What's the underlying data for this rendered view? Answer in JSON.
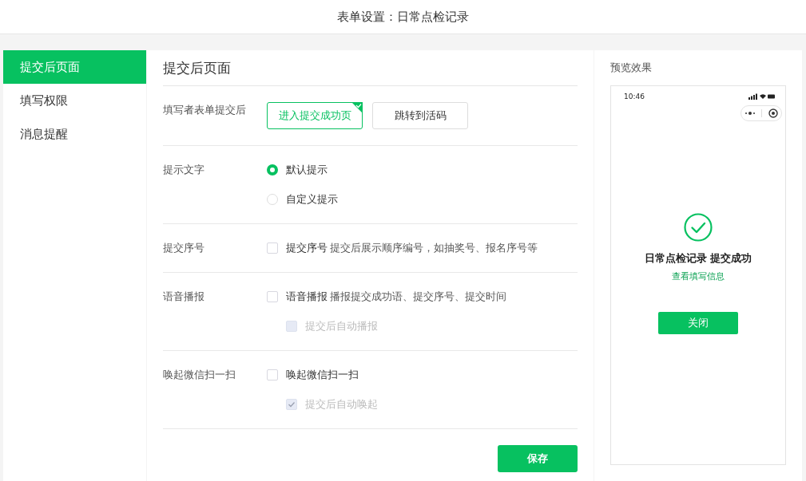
{
  "page_title": "表单设置：日常点检记录",
  "sidebar": {
    "items": [
      {
        "label": "提交后页面",
        "selected": true
      },
      {
        "label": "填写权限",
        "selected": false
      },
      {
        "label": "消息提醒",
        "selected": false
      }
    ]
  },
  "section_title": "提交后页面",
  "settings": [
    {
      "kind": "choice",
      "label": "填写者表单提交后",
      "options": [
        {
          "label": "进入提交成功页",
          "selected": true
        },
        {
          "label": "跳转到活码",
          "selected": false
        }
      ]
    },
    {
      "kind": "radio",
      "label": "提示文字",
      "options": [
        {
          "label": "默认提示",
          "selected": true
        },
        {
          "label": "自定义提示",
          "selected": false
        }
      ]
    },
    {
      "kind": "checkbox",
      "label": "提交序号",
      "options": [
        {
          "label": "提交序号",
          "description": "提交后展示顺序编号，如抽奖号、报名序号等",
          "checked": false,
          "disabled": false
        }
      ]
    },
    {
      "kind": "checkbox",
      "label": "语音播报",
      "options": [
        {
          "label": "语音播报",
          "description": "播报提交成功语、提交序号、提交时间",
          "checked": false,
          "disabled": false
        },
        {
          "label": "提交后自动播报",
          "checked": false,
          "disabled": true
        }
      ]
    },
    {
      "kind": "checkbox",
      "label": "唤起微信扫一扫",
      "options": [
        {
          "label": "唤起微信扫一扫",
          "checked": false,
          "disabled": false
        },
        {
          "label": "提交后自动唤起",
          "checked": true,
          "disabled": true
        }
      ]
    }
  ],
  "save_button": "保存",
  "preview": {
    "label": "预览效果",
    "time": "10:46",
    "message": "日常点检记录 提交成功",
    "link": "查看填写信息",
    "button": "关闭"
  }
}
